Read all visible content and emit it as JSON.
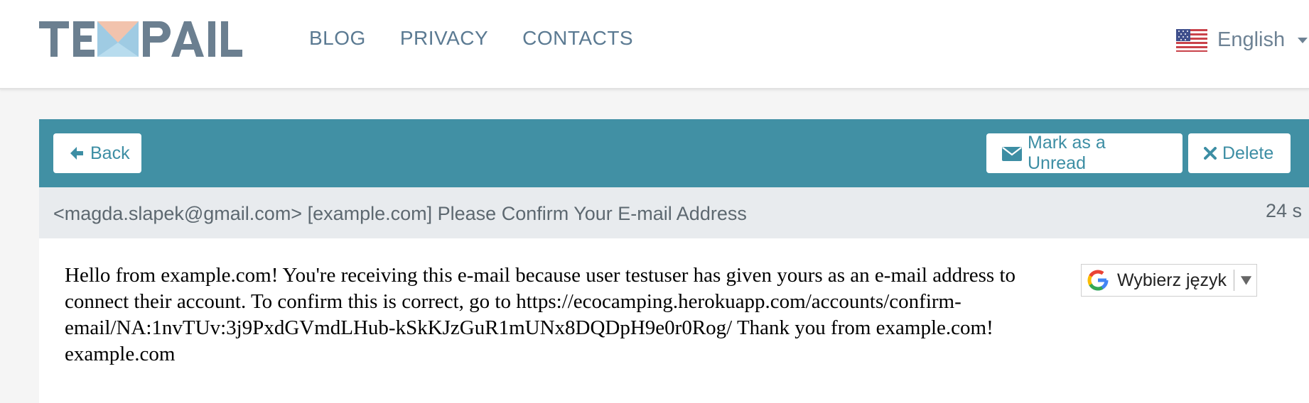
{
  "brand": {
    "logo_text": "TEMPAIL"
  },
  "nav": {
    "items": [
      {
        "label": "BLOG"
      },
      {
        "label": "PRIVACY"
      },
      {
        "label": "CONTACTS"
      }
    ]
  },
  "language": {
    "label": "English",
    "icon": "us-flag-icon"
  },
  "toolbar": {
    "back_label": "Back",
    "mark_unread_label": "Mark as a Unread",
    "delete_label": "Delete",
    "background_color": "#4190a4",
    "button_text_color": "#3d8ea4"
  },
  "email": {
    "subject_line": "<magda.slapek@gmail.com> [example.com] Please Confirm Your E-mail Address",
    "time_fragment": "24 s",
    "body": "Hello from example.com! You're receiving this e-mail because user testuser has given yours as an e-mail address to connect their account. To confirm this is correct, go to https://ecocamping.herokuapp.com/accounts/confirm-email/NA:1nvTUv:3j9PxdGVmdLHub-kSkKJzGuR1mUNx8DQDpH9e0r0Rog/ Thank you from example.com! example.com"
  },
  "translate": {
    "label": "Wybierz język"
  }
}
